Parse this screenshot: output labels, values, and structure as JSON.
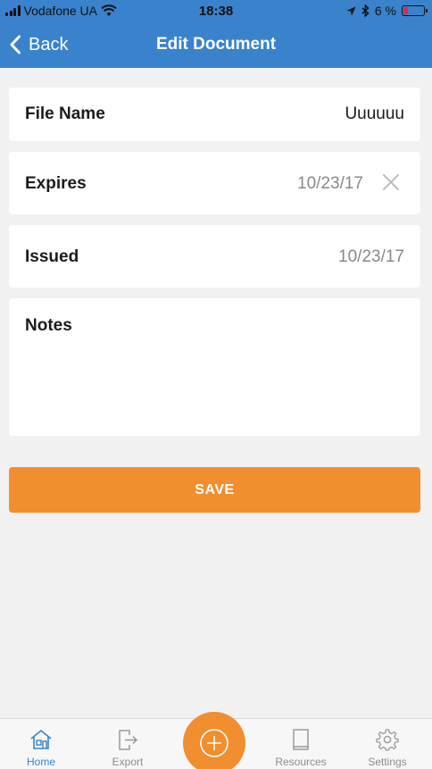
{
  "status_bar": {
    "carrier": "Vodafone UA",
    "time": "18:38",
    "battery_percent": "6 %",
    "battery_level": 0.06
  },
  "nav": {
    "back_label": "Back",
    "title": "Edit Document"
  },
  "form": {
    "file_name": {
      "label": "File Name",
      "value": "Uuuuuu"
    },
    "expires": {
      "label": "Expires",
      "value": "10/23/17"
    },
    "issued": {
      "label": "Issued",
      "value": "10/23/17"
    },
    "notes": {
      "label": "Notes",
      "value": ""
    }
  },
  "save_label": "SAVE",
  "tabs": [
    {
      "label": "Home",
      "icon": "home-icon",
      "active": true
    },
    {
      "label": "Export",
      "icon": "export-icon",
      "active": false
    },
    {
      "label": "Resources",
      "icon": "book-icon",
      "active": false
    },
    {
      "label": "Settings",
      "icon": "gear-icon",
      "active": false
    }
  ],
  "colors": {
    "header_blue": "#3a82cc",
    "accent_orange": "#f18e2f",
    "background": "#f1f1f1",
    "low_battery": "#e0274a"
  }
}
